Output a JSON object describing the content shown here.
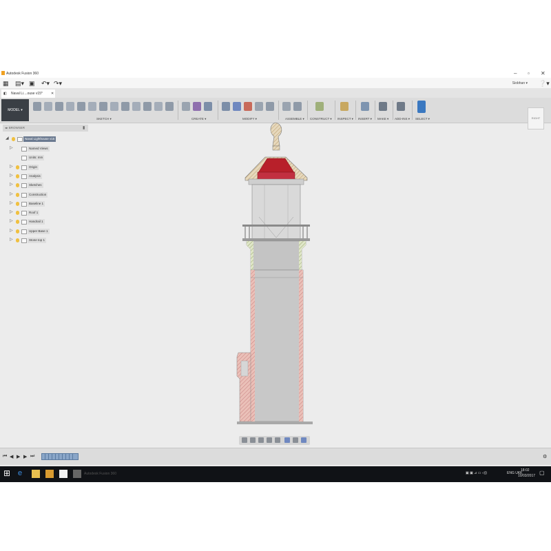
{
  "window": {
    "title": "Autodesk Fusion 360",
    "minimize": "–",
    "maximize": "▫",
    "close": "✕"
  },
  "quick_access": {
    "grid": "▦",
    "file": "▤▾",
    "save": "▣",
    "undo": "↶▾",
    "redo": "↷▾",
    "user": "Siobhan ▾",
    "help": "❔▾"
  },
  "document_tab": {
    "icon": "◧",
    "label": "Naval Li....ouse v15*",
    "close": "✕"
  },
  "ribbon": {
    "workspace": "MODEL ▾",
    "groups": [
      "SKETCH ▾",
      "CREATE ▾",
      "MODIFY ▾",
      "ASSEMBLE ▾",
      "CONSTRUCT ▾",
      "INSPECT ▾",
      "INSERT ▾",
      "MAKE ▾",
      "ADD-INS ▾",
      "SELECT ▾"
    ],
    "viewcube": "RIGHT"
  },
  "browser": {
    "header": "◂▸  BROWSER",
    "collapse": "▮",
    "root": "Naval Lighthouse v15",
    "items": [
      {
        "label": "Named Views",
        "expand": "▷"
      },
      {
        "label": "Units: mm",
        "expand": ""
      },
      {
        "label": "Origin",
        "expand": "▷"
      },
      {
        "label": "Analysis",
        "expand": "▷"
      },
      {
        "label": "Sketches",
        "expand": "▷"
      },
      {
        "label": "Construction",
        "expand": "▷"
      },
      {
        "label": "Baseline 1",
        "expand": "▷"
      },
      {
        "label": "Roof 1",
        "expand": "▷"
      },
      {
        "label": "Handrail 1",
        "expand": "▷"
      },
      {
        "label": "Upper Base 1",
        "expand": "▷"
      },
      {
        "label": "Stone top 1",
        "expand": "▷"
      }
    ]
  },
  "timeline": {
    "first": "⏮",
    "prev": "◀",
    "play": "▶",
    "next": "▶",
    "last": "⏭",
    "settings": "⚙"
  },
  "taskbar": {
    "start": "⊞",
    "app_label": "Autodesk Fusion 360",
    "tray_text": "ENG UKK",
    "time": "18:02",
    "date": "10/03/2017"
  },
  "colors": {
    "accent": "#6b7a90",
    "cutaway": "#e8b9b0",
    "roof": "#b8202a",
    "wood": "#d8c7a8"
  }
}
